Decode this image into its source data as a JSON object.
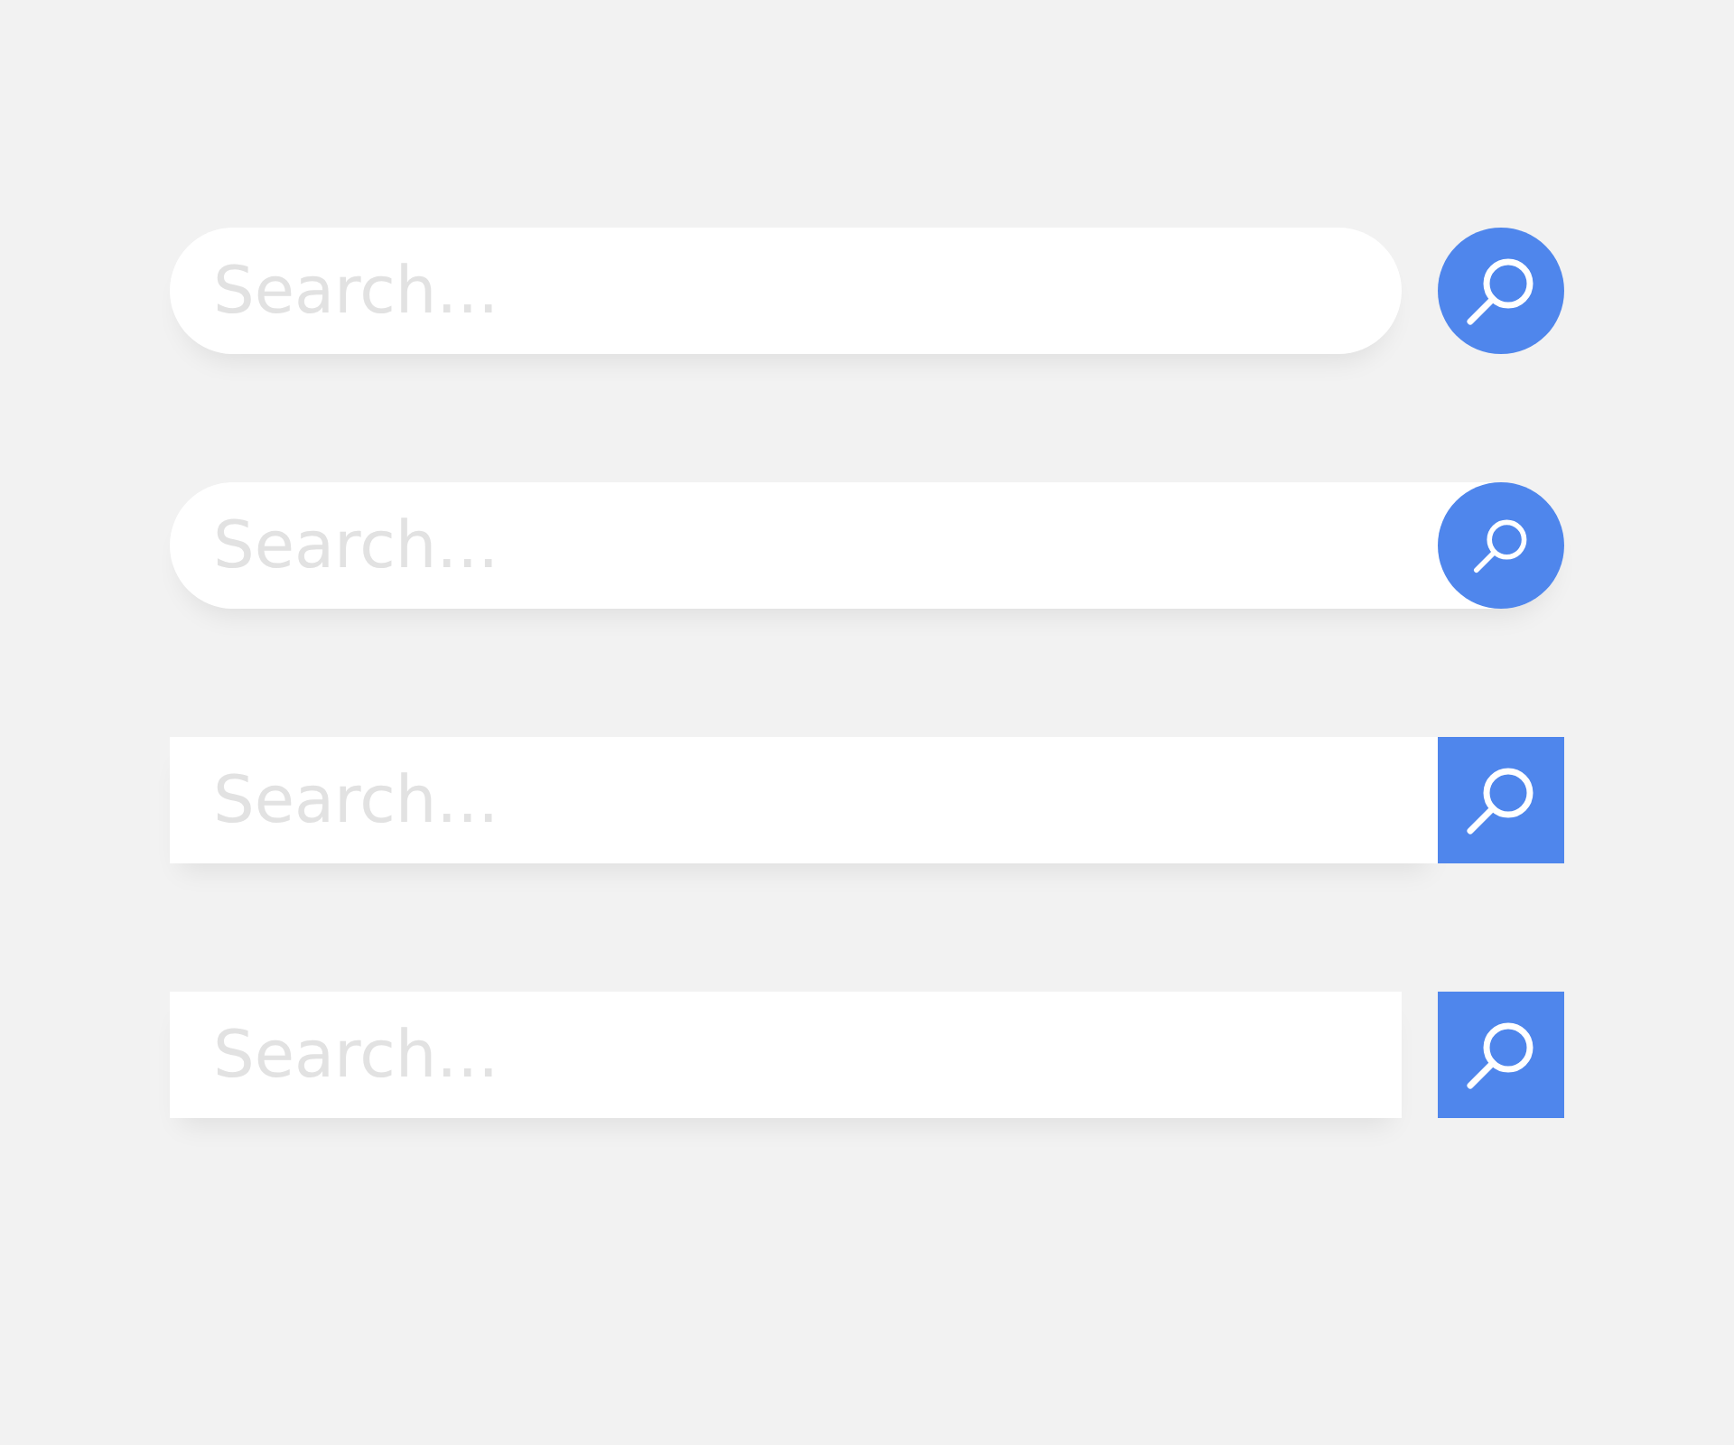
{
  "search_bars": [
    {
      "kind": "pill-separate",
      "placeholder": "Search..."
    },
    {
      "kind": "pill-inset",
      "placeholder": "Search..."
    },
    {
      "kind": "square-attached",
      "placeholder": "Search..."
    },
    {
      "kind": "square-separate",
      "placeholder": "Search..."
    }
  ]
}
